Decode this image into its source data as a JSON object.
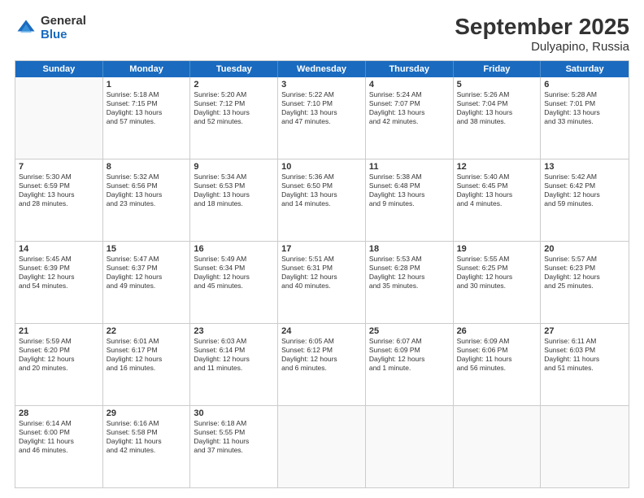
{
  "logo": {
    "general": "General",
    "blue": "Blue"
  },
  "title": "September 2025",
  "subtitle": "Dulyapino, Russia",
  "header_days": [
    "Sunday",
    "Monday",
    "Tuesday",
    "Wednesday",
    "Thursday",
    "Friday",
    "Saturday"
  ],
  "weeks": [
    [
      {
        "day": "",
        "lines": []
      },
      {
        "day": "1",
        "lines": [
          "Sunrise: 5:18 AM",
          "Sunset: 7:15 PM",
          "Daylight: 13 hours",
          "and 57 minutes."
        ]
      },
      {
        "day": "2",
        "lines": [
          "Sunrise: 5:20 AM",
          "Sunset: 7:12 PM",
          "Daylight: 13 hours",
          "and 52 minutes."
        ]
      },
      {
        "day": "3",
        "lines": [
          "Sunrise: 5:22 AM",
          "Sunset: 7:10 PM",
          "Daylight: 13 hours",
          "and 47 minutes."
        ]
      },
      {
        "day": "4",
        "lines": [
          "Sunrise: 5:24 AM",
          "Sunset: 7:07 PM",
          "Daylight: 13 hours",
          "and 42 minutes."
        ]
      },
      {
        "day": "5",
        "lines": [
          "Sunrise: 5:26 AM",
          "Sunset: 7:04 PM",
          "Daylight: 13 hours",
          "and 38 minutes."
        ]
      },
      {
        "day": "6",
        "lines": [
          "Sunrise: 5:28 AM",
          "Sunset: 7:01 PM",
          "Daylight: 13 hours",
          "and 33 minutes."
        ]
      }
    ],
    [
      {
        "day": "7",
        "lines": [
          "Sunrise: 5:30 AM",
          "Sunset: 6:59 PM",
          "Daylight: 13 hours",
          "and 28 minutes."
        ]
      },
      {
        "day": "8",
        "lines": [
          "Sunrise: 5:32 AM",
          "Sunset: 6:56 PM",
          "Daylight: 13 hours",
          "and 23 minutes."
        ]
      },
      {
        "day": "9",
        "lines": [
          "Sunrise: 5:34 AM",
          "Sunset: 6:53 PM",
          "Daylight: 13 hours",
          "and 18 minutes."
        ]
      },
      {
        "day": "10",
        "lines": [
          "Sunrise: 5:36 AM",
          "Sunset: 6:50 PM",
          "Daylight: 13 hours",
          "and 14 minutes."
        ]
      },
      {
        "day": "11",
        "lines": [
          "Sunrise: 5:38 AM",
          "Sunset: 6:48 PM",
          "Daylight: 13 hours",
          "and 9 minutes."
        ]
      },
      {
        "day": "12",
        "lines": [
          "Sunrise: 5:40 AM",
          "Sunset: 6:45 PM",
          "Daylight: 13 hours",
          "and 4 minutes."
        ]
      },
      {
        "day": "13",
        "lines": [
          "Sunrise: 5:42 AM",
          "Sunset: 6:42 PM",
          "Daylight: 12 hours",
          "and 59 minutes."
        ]
      }
    ],
    [
      {
        "day": "14",
        "lines": [
          "Sunrise: 5:45 AM",
          "Sunset: 6:39 PM",
          "Daylight: 12 hours",
          "and 54 minutes."
        ]
      },
      {
        "day": "15",
        "lines": [
          "Sunrise: 5:47 AM",
          "Sunset: 6:37 PM",
          "Daylight: 12 hours",
          "and 49 minutes."
        ]
      },
      {
        "day": "16",
        "lines": [
          "Sunrise: 5:49 AM",
          "Sunset: 6:34 PM",
          "Daylight: 12 hours",
          "and 45 minutes."
        ]
      },
      {
        "day": "17",
        "lines": [
          "Sunrise: 5:51 AM",
          "Sunset: 6:31 PM",
          "Daylight: 12 hours",
          "and 40 minutes."
        ]
      },
      {
        "day": "18",
        "lines": [
          "Sunrise: 5:53 AM",
          "Sunset: 6:28 PM",
          "Daylight: 12 hours",
          "and 35 minutes."
        ]
      },
      {
        "day": "19",
        "lines": [
          "Sunrise: 5:55 AM",
          "Sunset: 6:25 PM",
          "Daylight: 12 hours",
          "and 30 minutes."
        ]
      },
      {
        "day": "20",
        "lines": [
          "Sunrise: 5:57 AM",
          "Sunset: 6:23 PM",
          "Daylight: 12 hours",
          "and 25 minutes."
        ]
      }
    ],
    [
      {
        "day": "21",
        "lines": [
          "Sunrise: 5:59 AM",
          "Sunset: 6:20 PM",
          "Daylight: 12 hours",
          "and 20 minutes."
        ]
      },
      {
        "day": "22",
        "lines": [
          "Sunrise: 6:01 AM",
          "Sunset: 6:17 PM",
          "Daylight: 12 hours",
          "and 16 minutes."
        ]
      },
      {
        "day": "23",
        "lines": [
          "Sunrise: 6:03 AM",
          "Sunset: 6:14 PM",
          "Daylight: 12 hours",
          "and 11 minutes."
        ]
      },
      {
        "day": "24",
        "lines": [
          "Sunrise: 6:05 AM",
          "Sunset: 6:12 PM",
          "Daylight: 12 hours",
          "and 6 minutes."
        ]
      },
      {
        "day": "25",
        "lines": [
          "Sunrise: 6:07 AM",
          "Sunset: 6:09 PM",
          "Daylight: 12 hours",
          "and 1 minute."
        ]
      },
      {
        "day": "26",
        "lines": [
          "Sunrise: 6:09 AM",
          "Sunset: 6:06 PM",
          "Daylight: 11 hours",
          "and 56 minutes."
        ]
      },
      {
        "day": "27",
        "lines": [
          "Sunrise: 6:11 AM",
          "Sunset: 6:03 PM",
          "Daylight: 11 hours",
          "and 51 minutes."
        ]
      }
    ],
    [
      {
        "day": "28",
        "lines": [
          "Sunrise: 6:14 AM",
          "Sunset: 6:00 PM",
          "Daylight: 11 hours",
          "and 46 minutes."
        ]
      },
      {
        "day": "29",
        "lines": [
          "Sunrise: 6:16 AM",
          "Sunset: 5:58 PM",
          "Daylight: 11 hours",
          "and 42 minutes."
        ]
      },
      {
        "day": "30",
        "lines": [
          "Sunrise: 6:18 AM",
          "Sunset: 5:55 PM",
          "Daylight: 11 hours",
          "and 37 minutes."
        ]
      },
      {
        "day": "",
        "lines": []
      },
      {
        "day": "",
        "lines": []
      },
      {
        "day": "",
        "lines": []
      },
      {
        "day": "",
        "lines": []
      }
    ]
  ]
}
